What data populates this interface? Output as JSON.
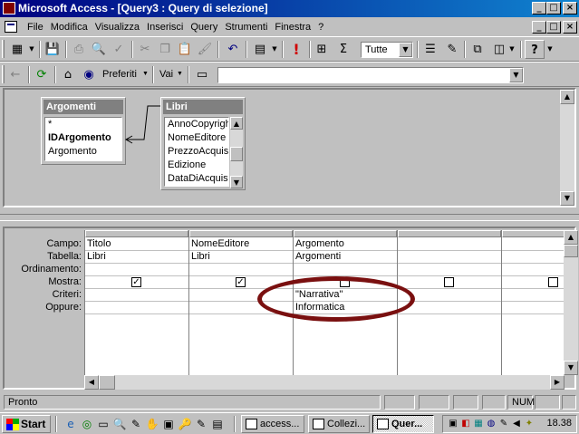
{
  "window": {
    "title": "Microsoft Access - [Query3 : Query di selezione]",
    "min": "_",
    "max": "□",
    "close": "×"
  },
  "menu": [
    {
      "label": "File"
    },
    {
      "label": "Modifica"
    },
    {
      "label": "Visualizza"
    },
    {
      "label": "Inserisci"
    },
    {
      "label": "Query"
    },
    {
      "label": "Strumenti"
    },
    {
      "label": "Finestra"
    },
    {
      "label": "?"
    }
  ],
  "toolbar": {
    "top_values": "Tutte",
    "sigma": "Σ",
    "run": "!"
  },
  "web_toolbar": {
    "favorites": "Preferiti",
    "go": "Vai",
    "address": ""
  },
  "tables": [
    {
      "name": "Argomenti",
      "fields": [
        "*",
        "IDArgomento",
        "Argomento"
      ],
      "key_field": "IDArgomento"
    },
    {
      "name": "Libri",
      "fields": [
        "AnnoCopyright",
        "NomeEditore",
        "PrezzoAcquisto",
        "Edizione",
        "DataDiAcquisto"
      ]
    }
  ],
  "grid": {
    "row_labels": [
      "Campo:",
      "Tabella:",
      "Ordinamento:",
      "Mostra:",
      "Criteri:",
      "Oppure:"
    ],
    "columns": [
      {
        "field": "Titolo",
        "table": "Libri",
        "sort": "",
        "show": true,
        "criteria": "",
        "or": ""
      },
      {
        "field": "NomeEditore",
        "table": "Libri",
        "sort": "",
        "show": true,
        "criteria": "",
        "or": ""
      },
      {
        "field": "Argomento",
        "table": "Argomenti",
        "sort": "",
        "show": false,
        "criteria": "\"Narrativa\"",
        "or": "Informatica"
      },
      {
        "field": "",
        "table": "",
        "sort": "",
        "show": false,
        "criteria": "",
        "or": ""
      },
      {
        "field": "",
        "table": "",
        "sort": "",
        "show": false,
        "criteria": "",
        "or": ""
      }
    ],
    "check_mark": "✓"
  },
  "status": {
    "text": "Pronto",
    "num": "NUM"
  },
  "taskbar": {
    "start": "Start",
    "tasks": [
      {
        "label": "access..."
      },
      {
        "label": "Collezi..."
      },
      {
        "label": "Quer..."
      }
    ],
    "clock": "18.38"
  },
  "colors": {
    "title_active": "#000080",
    "face": "#c0c0c0",
    "highlight_oval": "#7a1010"
  }
}
